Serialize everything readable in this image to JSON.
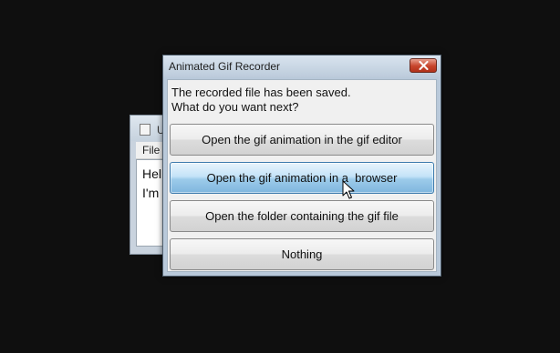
{
  "background_window": {
    "title": "U",
    "menu": {
      "file": "File"
    },
    "content_lines": [
      "Hell",
      "I'm"
    ]
  },
  "dialog": {
    "title": "Animated Gif Recorder",
    "close_icon": "close-icon",
    "message_line1": "The recorded file has been saved.",
    "message_line2": "What do you want next?",
    "options": [
      {
        "label": "Open the gif animation in the gif editor"
      },
      {
        "label": "Open the gif animation in a  browser",
        "state": "hover"
      },
      {
        "label": "Open the folder containing the gif file"
      },
      {
        "label": "Nothing"
      }
    ]
  },
  "colors": {
    "desktop": "#0f0f0f",
    "close_button": "#c7442b",
    "hover_button": "#9ccbea"
  }
}
